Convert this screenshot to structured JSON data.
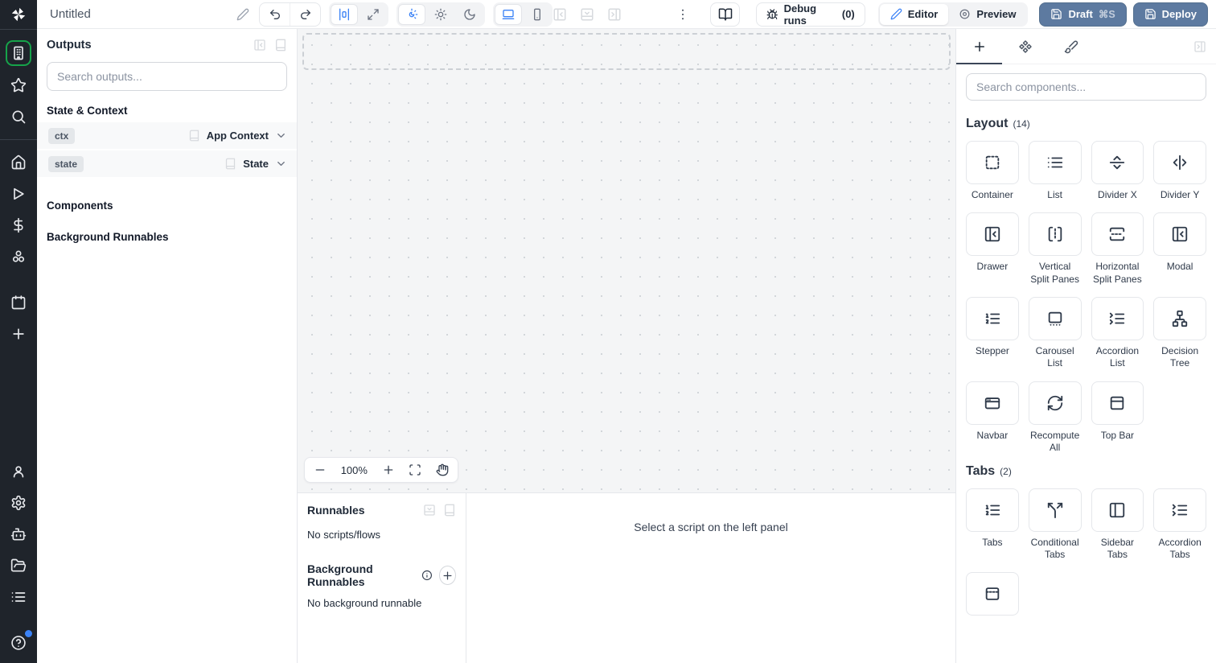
{
  "topbar": {
    "title": "Untitled",
    "debug_runs_label": "Debug runs",
    "debug_runs_count": "(0)",
    "editor_label": "Editor",
    "preview_label": "Preview",
    "draft_label": "Draft",
    "draft_shortcut": "⌘S",
    "deploy_label": "Deploy"
  },
  "rail": {
    "primary": [
      {
        "name": "apps",
        "icon": "building-icon",
        "selected": true
      },
      {
        "name": "favorites",
        "icon": "star-icon"
      },
      {
        "name": "search",
        "icon": "search-icon"
      }
    ],
    "nav": [
      {
        "name": "home",
        "icon": "home-icon"
      },
      {
        "name": "runs",
        "icon": "play-icon"
      },
      {
        "name": "variables",
        "icon": "dollar-icon"
      },
      {
        "name": "resources",
        "icon": "cluster-icon"
      },
      {
        "name": "schedules",
        "icon": "calendar-icon",
        "gap": true
      },
      {
        "name": "more",
        "icon": "plus-icon"
      }
    ],
    "bottom": [
      {
        "name": "user",
        "icon": "user-icon"
      },
      {
        "name": "settings",
        "icon": "gear-icon"
      },
      {
        "name": "workers",
        "icon": "bot-icon"
      },
      {
        "name": "folders",
        "icon": "folder-icon"
      },
      {
        "name": "logs",
        "icon": "list-menu-icon"
      },
      {
        "name": "help",
        "icon": "help-icon",
        "badge": true,
        "gap": true
      }
    ]
  },
  "left_panel": {
    "title": "Outputs",
    "search_placeholder": "Search outputs...",
    "state_context_title": "State & Context",
    "rows": [
      {
        "badge": "ctx",
        "type": "App Context"
      },
      {
        "badge": "state",
        "type": "State"
      }
    ],
    "components_title": "Components",
    "background_title": "Background Runnables"
  },
  "canvas": {
    "zoom_level": "100%"
  },
  "bottom_panel": {
    "runnables_title": "Runnables",
    "runnables_empty": "No scripts/flows",
    "background_title": "Background Runnables",
    "background_empty": "No background runnable",
    "script_placeholder": "Select a script on the left panel"
  },
  "right_panel": {
    "search_placeholder": "Search components...",
    "sections": [
      {
        "title": "Layout",
        "count": "(14)",
        "items": [
          {
            "label": "Container",
            "icon": "container-icon"
          },
          {
            "label": "List",
            "icon": "list-icon"
          },
          {
            "label": "Divider X",
            "icon": "divider-x-icon"
          },
          {
            "label": "Divider Y",
            "icon": "divider-y-icon"
          },
          {
            "label": "Drawer",
            "icon": "drawer-icon"
          },
          {
            "label": "Vertical Split Panes",
            "icon": "vertical-split-icon"
          },
          {
            "label": "Horizontal Split Panes",
            "icon": "horizontal-split-icon"
          },
          {
            "label": "Modal",
            "icon": "modal-icon"
          },
          {
            "label": "Stepper",
            "icon": "stepper-icon"
          },
          {
            "label": "Carousel List",
            "icon": "carousel-icon"
          },
          {
            "label": "Accordion List",
            "icon": "accordion-list-icon"
          },
          {
            "label": "Decision Tree",
            "icon": "decision-tree-icon"
          },
          {
            "label": "Navbar",
            "icon": "navbar-icon"
          },
          {
            "label": "Recompute All",
            "icon": "recompute-icon"
          },
          {
            "label": "Top Bar",
            "icon": "top-bar-icon"
          }
        ]
      },
      {
        "title": "Tabs",
        "count": "(2)",
        "items": [
          {
            "label": "Tabs",
            "icon": "tabs-icon"
          },
          {
            "label": "Conditional Tabs",
            "icon": "conditional-tabs-icon"
          },
          {
            "label": "Sidebar Tabs",
            "icon": "sidebar-tabs-icon"
          },
          {
            "label": "Accordion Tabs",
            "icon": "accordion-tabs-icon"
          },
          {
            "label": "",
            "icon": "invisible-tabs-icon"
          }
        ]
      }
    ]
  },
  "colors": {
    "accent_blue": "#3b82f6",
    "selected_green": "#16a34a",
    "primary_button": "#5d7aa0",
    "rail_background": "#1f242b"
  }
}
